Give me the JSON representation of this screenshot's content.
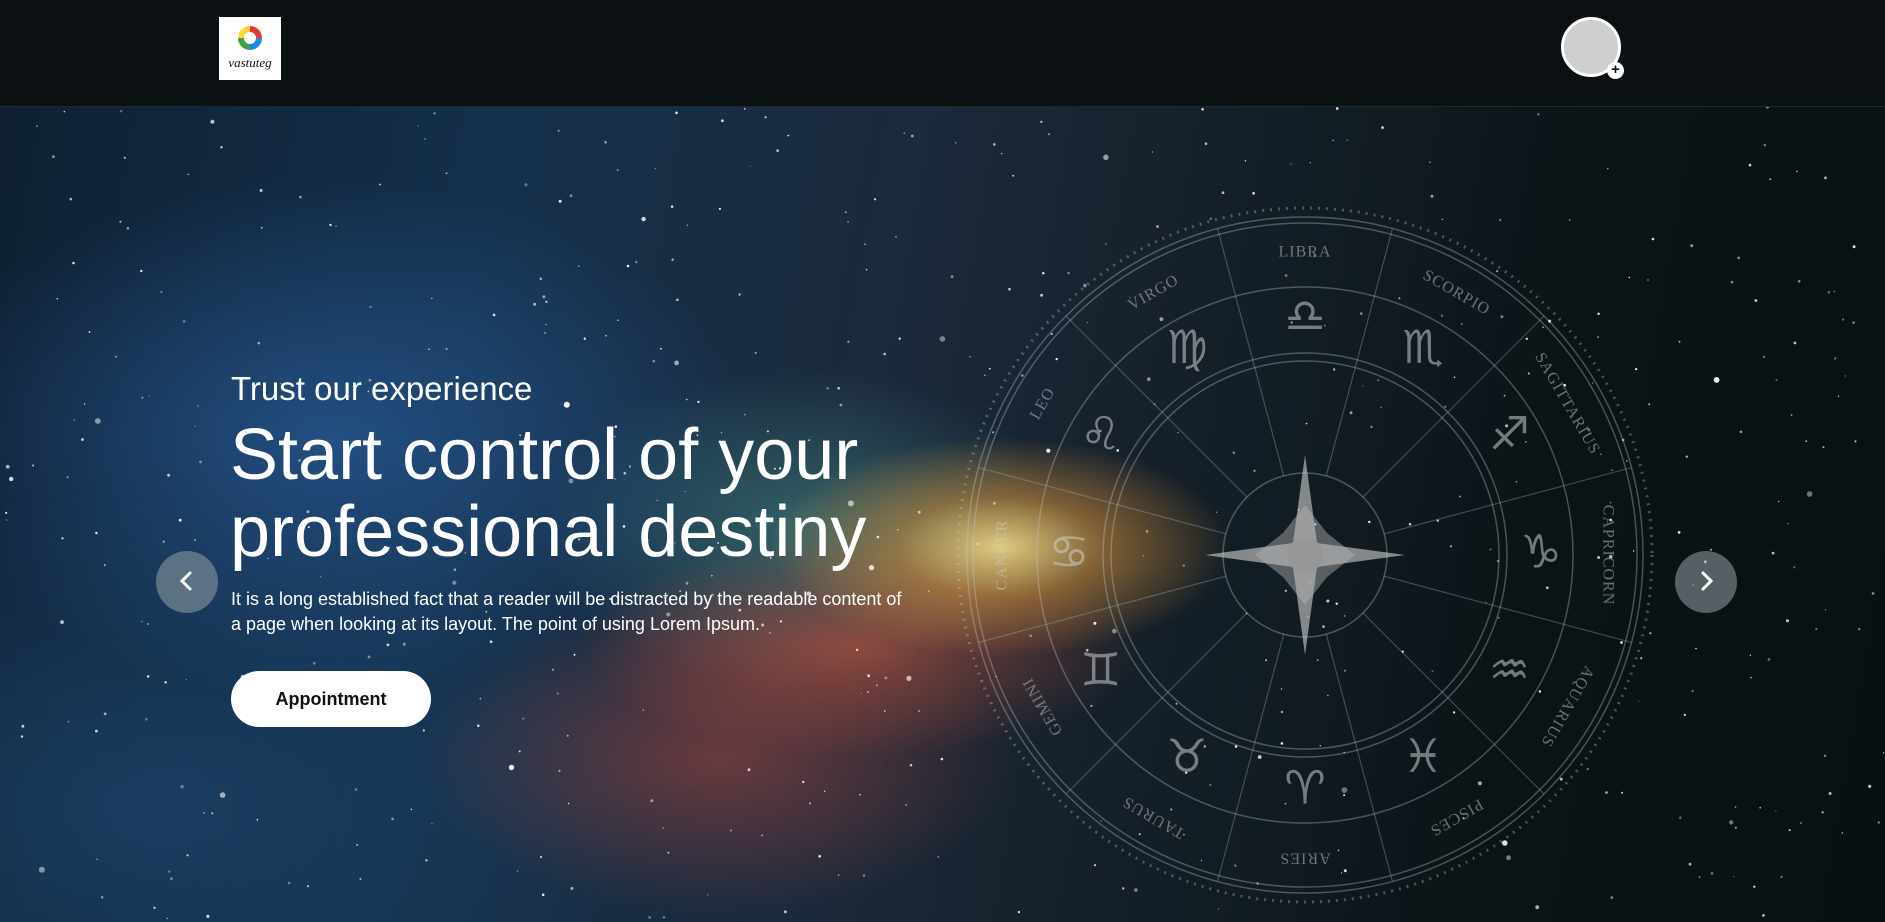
{
  "header": {
    "logo_text": "vastuteg",
    "avatar_label": "",
    "avatar_add": "+"
  },
  "hero": {
    "subtitle": "Trust our experience",
    "title": "Start control of your professional destiny",
    "description": "It is a long established fact that a reader will be distracted by the readable content of a page when looking at its layout. The point of using Lorem Ipsum.",
    "cta_label": "Appointment"
  },
  "carousel": {
    "prev_icon": "chevron-left-icon",
    "next_icon": "chevron-right-icon"
  },
  "zodiac_wheel": {
    "signs": [
      {
        "name": "LIBRA",
        "glyph": "♎"
      },
      {
        "name": "SCORPIO",
        "glyph": "♏"
      },
      {
        "name": "SAGITTARIUS",
        "glyph": "♐"
      },
      {
        "name": "CAPRICORN",
        "glyph": "♑"
      },
      {
        "name": "AQUARIUS",
        "glyph": "♒"
      },
      {
        "name": "PISCES",
        "glyph": "♓"
      },
      {
        "name": "ARIES",
        "glyph": "♈"
      },
      {
        "name": "TAURUS",
        "glyph": "♉"
      },
      {
        "name": "GEMINI",
        "glyph": "♊"
      },
      {
        "name": "CANCER",
        "glyph": "♋"
      },
      {
        "name": "LEO",
        "glyph": "♌"
      },
      {
        "name": "VIRGO",
        "glyph": "♍"
      }
    ]
  },
  "colors": {
    "header_bg": "#0b1012",
    "button_bg": "#ffffff",
    "arrow_bg": "#969fa5"
  }
}
